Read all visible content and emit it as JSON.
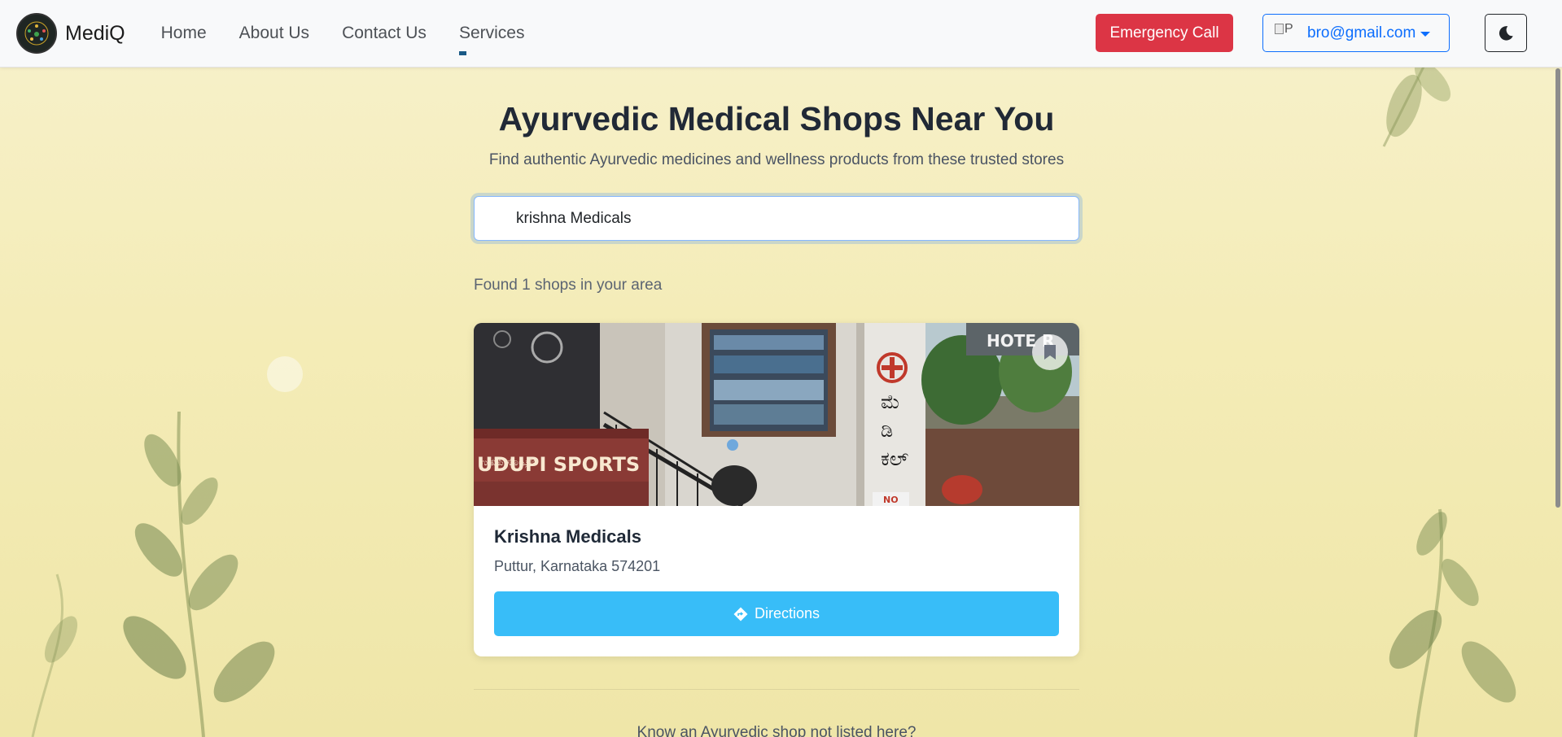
{
  "navbar": {
    "brand_name": "MediQ",
    "links": [
      {
        "label": "Home"
      },
      {
        "label": "About Us"
      },
      {
        "label": "Contact Us"
      },
      {
        "label": "Services"
      }
    ],
    "emergency_label": "Emergency Call",
    "user_image_alt": "P",
    "user_email": "bro@gmail.com",
    "theme_icon": "moon-icon"
  },
  "main": {
    "title": "Ayurvedic Medical Shops Near You",
    "subtitle": "Find authentic Ayurvedic medicines and wellness products from these trusted stores",
    "search_value": "krishna Medicals",
    "found_text": "Found 1 shops in your area",
    "shops": [
      {
        "name": "Krishna Medicals",
        "address": "Puttur, Karnataka 574201",
        "directions_label": "Directions",
        "photo_texts": {
          "shop_sign": "UDUPI SPORTS",
          "hotel_sign": "HOTE R",
          "no_sign": "NO"
        }
      }
    ],
    "footer_text": "Know an Ayurvedic shop not listed here?"
  },
  "colors": {
    "emergency": "#dc3545",
    "primary": "#0d6efd",
    "directions": "#38bdf8",
    "background": "#f6efc4"
  }
}
